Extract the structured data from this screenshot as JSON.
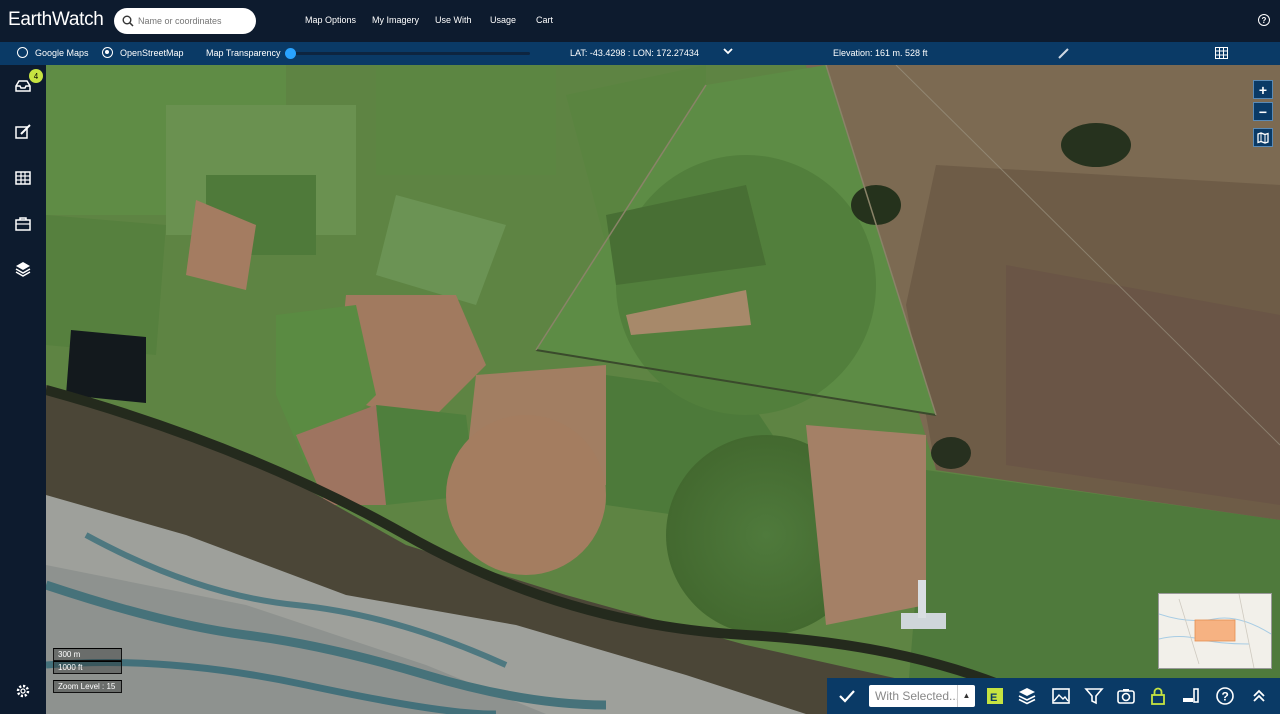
{
  "app": {
    "title": "EarthWatch"
  },
  "search": {
    "placeholder": "Name or coordinates"
  },
  "nav": {
    "items": [
      "Map Options",
      "My Imagery",
      "Use With",
      "Usage",
      "Cart"
    ]
  },
  "help": {
    "label": "?"
  },
  "subbar": {
    "google_maps": "Google Maps",
    "openstreetmap": "OpenStreetMap",
    "selected_basemap": "OpenStreetMap",
    "map_transparency": "Map Transparency",
    "transparency_value": 0,
    "coords": "LAT: -43.4298 : LON: 172.27434",
    "elevation": "Elevation: 161 m. 528 ft"
  },
  "sidebar": {
    "inbox_badge": "4",
    "items": [
      "inbox-icon",
      "edit-icon",
      "grid-icon",
      "briefcase-icon",
      "layers-icon",
      "settings-icon"
    ]
  },
  "map_controls": {
    "zoom_in": "+",
    "zoom_out": "−"
  },
  "scale": {
    "meters": "300 m",
    "feet": "1000 ft",
    "zoom": "Zoom Level : 15"
  },
  "bottombar": {
    "with_selected": "With Selected...",
    "caret": "▲"
  },
  "colors": {
    "topbar": "#0d1b2e",
    "subbar": "#0a3a66",
    "accent": "#29a3ff",
    "badge": "#c6e341",
    "lock": "#c6e341"
  }
}
